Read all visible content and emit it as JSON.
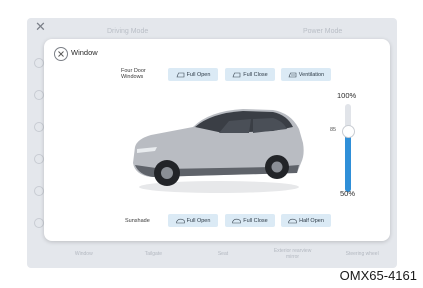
{
  "background": {
    "left_title": "Driving Mode",
    "right_title": "Power Mode",
    "bottom_items": [
      "Window",
      "Tailgate",
      "Seat",
      "Exterior rearview mirror",
      "Steering wheel"
    ]
  },
  "dialog": {
    "title": "Window",
    "windows_label": "Four Door Windows",
    "window_buttons": [
      "Full Open",
      "Full Close",
      "Ventilation"
    ],
    "sunshade_label": "Sunshade",
    "sunshade_buttons": [
      "Full Open",
      "Full Close",
      "Half Open"
    ],
    "slider": {
      "max_label": "100%",
      "min_label": "50%",
      "value": 85,
      "min": 50,
      "max": 100
    }
  },
  "watermark": "OMX65-4161",
  "colors": {
    "chip_bg": "#dbeaf5",
    "accent": "#2f8fd8",
    "screen_bg": "#e4e7ec",
    "car_body": "#b9bcc2"
  },
  "icons": {
    "close": "close-icon",
    "window": "window-icon",
    "ventilation": "ventilation-icon",
    "sunshade": "sunshade-icon"
  }
}
